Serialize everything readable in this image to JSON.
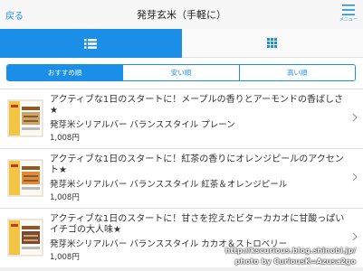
{
  "navbar": {
    "back_label": "戻る",
    "title": "発芽玄米（手軽に）",
    "menu_label": "メニュー"
  },
  "view_tabs": [
    {
      "icon": "list-icon",
      "active": true
    },
    {
      "icon": "grid-icon",
      "active": false
    }
  ],
  "sort_options": [
    {
      "label": "おすすめ順",
      "active": true
    },
    {
      "label": "安い順",
      "active": false
    },
    {
      "label": "高い順",
      "active": false
    }
  ],
  "products": [
    {
      "description": "アクティブな1日のスタートに！メープルの香りとアーモンドの香ばしさ★",
      "name": "発芽米シリアルバー バランススタイル プレーン",
      "price": "1,008円",
      "accent": "#c9a56b"
    },
    {
      "description": "アクティブな1日のスタートに！紅茶の香りにオレンジピールのアクセント★",
      "name": "発芽米シリアルバー バランススタイル 紅茶＆オレンジピール",
      "price": "1,008円",
      "accent": "#e08a3c"
    },
    {
      "description": "アクティブな1日のスタートに！甘さを控えたビターカカオに甘酸っぱいイチゴの大人味★",
      "name": "発芽米シリアルバー バランススタイル カカオ＆ストロベリー",
      "price": "1,008円",
      "accent": "#7a4a35"
    }
  ],
  "watermark": {
    "line1": "http://kscurious.blog.shinobi.jp/",
    "line2": "photo by CuriousK=Azusa2go"
  },
  "colors": {
    "accent": "#1b8ee8"
  }
}
